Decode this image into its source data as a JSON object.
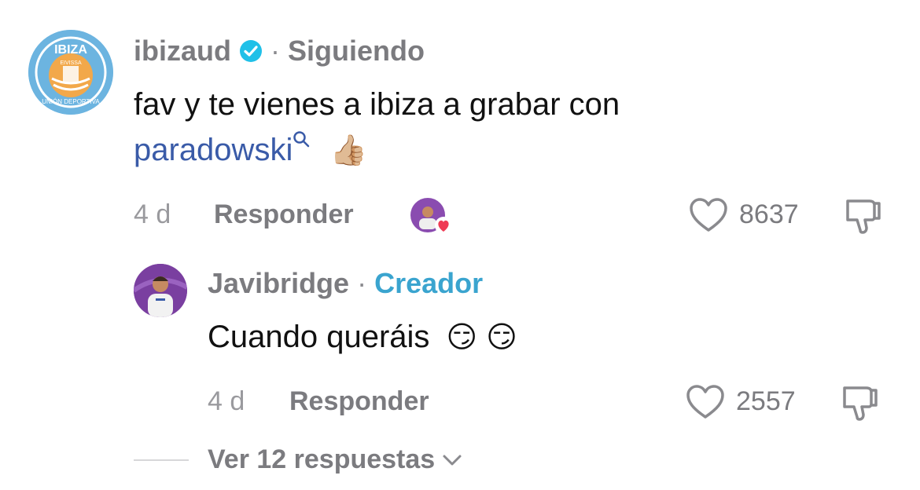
{
  "comment": {
    "username": "ibizaud",
    "dot": "·",
    "follow_status": "Siguiendo",
    "text_line1": "fav y te vienes a ibiza a grabar con",
    "mention": "paradowski",
    "emoji": "👍🏼",
    "time": "4 d",
    "reply_label": "Responder",
    "likes": "8637",
    "avatar_text": "IBIZA",
    "avatar_subtext": "EIVISSA",
    "avatar_ring_text": "UNIÓN DEPORTIVA"
  },
  "reply": {
    "username": "Javibridge",
    "dot": "·",
    "role": "Creador",
    "text": "Cuando queráis",
    "emoji1": "😏",
    "emoji2": "😏",
    "time": "4 d",
    "reply_label": "Responder",
    "likes": "2557"
  },
  "view_more": {
    "label": "Ver 12 respuestas"
  },
  "colors": {
    "mention": "#3a5ba8",
    "creator": "#3aa4cf",
    "verified": "#20c0e8",
    "heart_badge": "#ef3b55"
  },
  "icons": [
    "verified-icon",
    "search-icon",
    "heart-icon",
    "dislike-icon",
    "chevron-down-icon"
  ]
}
